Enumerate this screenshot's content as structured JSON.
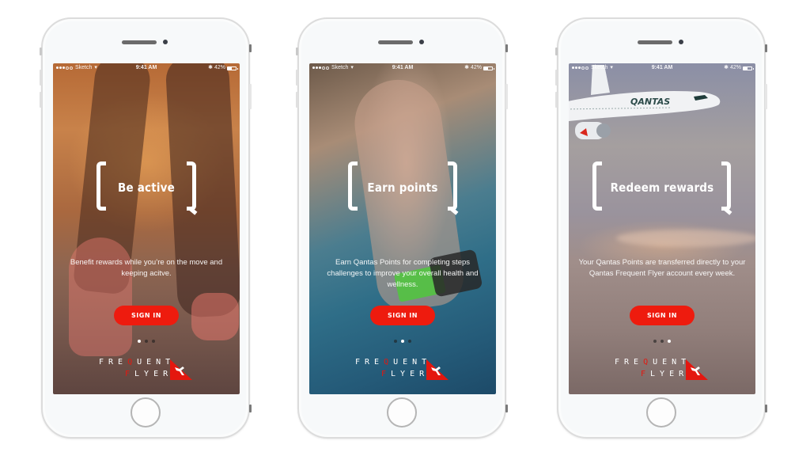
{
  "status_bar": {
    "carrier": "Sketch",
    "time": "9:41 AM",
    "battery": "42%"
  },
  "screens": [
    {
      "headline": "Be active",
      "description": "Benefit rewards while you’re on the move and keeping acitve.",
      "signin_label": "SIGN IN",
      "active_page": 0
    },
    {
      "headline": "Earn points",
      "description": "Earn Qantas Points for completing steps challenges to improve your overall health and wellness.",
      "signin_label": "SIGN IN",
      "active_page": 1
    },
    {
      "headline": "Redeem rewards",
      "description": "Your Qantas Points are transferred directly to your Qantas Frequent Flyer account every week.",
      "signin_label": "SIGN IN",
      "active_page": 2
    }
  ],
  "pager": {
    "total_pages": 3
  },
  "logo": {
    "line1_pre": "FRE",
    "line1_red": "Q",
    "line1_post": "UENT",
    "line2_red": "F",
    "line2_post": "LYER",
    "airline_text": "QANTAS"
  },
  "colors": {
    "accent_red": "#ee1b0e",
    "logo_red": "#e4170f"
  }
}
